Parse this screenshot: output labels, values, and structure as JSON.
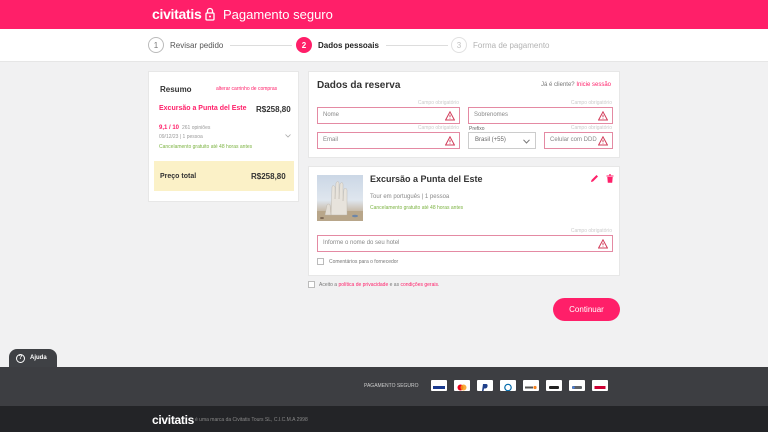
{
  "header": {
    "logo": "civitatis",
    "title": "Pagamento seguro",
    "background": "#ff1f69"
  },
  "steps": [
    {
      "number": "1",
      "label": "Revisar pedido"
    },
    {
      "number": "2",
      "label": "Dados pessoais"
    },
    {
      "number": "3",
      "label": "Forma de pagamento"
    }
  ],
  "summary": {
    "title": "Resumo",
    "change_link": "alterar carrinho de compras",
    "tour_name": "Excursão a Punta del Este",
    "price": "R$258,80",
    "rating": "9,1 / 10",
    "opinions": "261 opiniões",
    "date_people": "09/12/23  |  1 pessoa",
    "cancellation": "Cancelamento gratuito até 48 horas antes",
    "total_label": "Preço total",
    "total_value": "R$258,80"
  },
  "booking": {
    "title": "Dados da reserva",
    "already_client": "Já é cliente?",
    "login_link": "Inicie sessão",
    "required": "Campo obrigatório",
    "name_placeholder": "Nome",
    "surname_placeholder": "Sobrenomes",
    "email_placeholder": "Email",
    "prefix_label": "Prefixo",
    "prefix_value": "Brasil (+55)",
    "phone_placeholder": "Celular com DDD"
  },
  "tour": {
    "title": "Excursão a Punta del Este",
    "info": "Tour em português | 1 pessoa",
    "cancellation": "Cancelamento gratuito até 48 horas antes",
    "required": "Campo obrigatório",
    "hotel_placeholder": "Informe o nome do seu hotel",
    "comments_label": "Comentários para o fornecedor"
  },
  "terms": {
    "prefix": "Aceito a",
    "privacy_link": "política de privacidade",
    "middle": "e as",
    "conditions_link": "condições gerais",
    "suffix": "."
  },
  "continue_label": "Continuar",
  "help_label": "Ajuda",
  "footer": {
    "payment_label": "PAGAMENTO SEGURO",
    "payment_methods": [
      "visa-icon",
      "mastercard-icon",
      "paypal-icon",
      "diners-icon",
      "discover-icon",
      "apple-pay-icon",
      "google-pay-icon",
      "maestro-icon"
    ],
    "logo": "civitatis",
    "legal": "é uma marca da Civitatis Tours SL, C.I.C.M.A 2998"
  },
  "colors": {
    "accent": "#ff1f69",
    "success": "#7cb342",
    "total_bg": "#fbf1c7"
  }
}
